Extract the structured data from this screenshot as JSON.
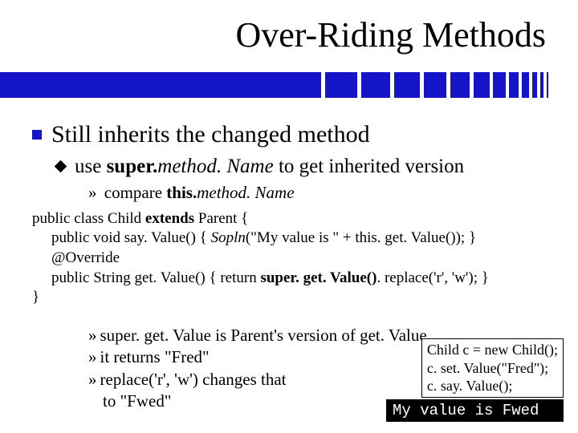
{
  "title": "Over-Riding Methods",
  "bullet1": "Still inherits the changed method",
  "sub1": {
    "pre": "use ",
    "bold1": "super.",
    "ital": "method. Name",
    "post": " to get inherited version"
  },
  "sub2a": {
    "arrow": "»",
    "pre": " compare ",
    "bold": "this.",
    "ital": "method. Name"
  },
  "code": {
    "l1a": "public class Child ",
    "l1b": "extends",
    "l1c": " Parent {",
    "l2a": "public void say. Value() { ",
    "l2b": "Sopln",
    "l2c": "(\"My value is \" + this. get. Value()); }",
    "l3": "@Override",
    "l4a": "public String get. Value() { return ",
    "l4b": "super. get. Value()",
    "l4c": ". replace('r', 'w'); }",
    "l5": "}"
  },
  "lower": {
    "arrow": "»",
    "r1": " super. get. Value is Parent's version of get. Value",
    "r2": " it returns \"Fred\"",
    "r3a": " replace('r', 'w') changes that",
    "r3b": "to \"Fwed\""
  },
  "sidebox": {
    "l1": "Child c = new Child();",
    "l2": "c. set. Value(\"Fred\");",
    "l3": "c. say. Value();"
  },
  "console": "My value is Fwed"
}
